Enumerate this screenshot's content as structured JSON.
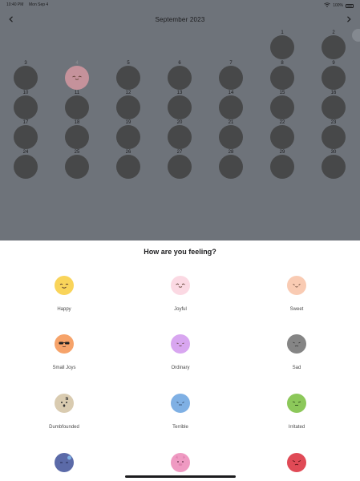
{
  "status_bar": {
    "time": "10:40 PM",
    "date": "Mon Sep 4",
    "battery": "100%",
    "wifi_icon": "wifi-icon",
    "battery_icon": "battery-icon"
  },
  "calendar": {
    "month_title": "September 2023",
    "prev_icon": "chevron-left-icon",
    "next_icon": "chevron-right-icon",
    "days": [
      {
        "day": "1",
        "mood": null
      },
      {
        "day": "2",
        "mood": null
      },
      {
        "day": "3",
        "mood": null
      },
      {
        "day": "4",
        "mood": "Joyful",
        "today": true
      },
      {
        "day": "5",
        "mood": null
      },
      {
        "day": "6",
        "mood": null
      },
      {
        "day": "7",
        "mood": null
      },
      {
        "day": "8",
        "mood": null
      },
      {
        "day": "9",
        "mood": null
      },
      {
        "day": "10",
        "mood": null
      },
      {
        "day": "11",
        "mood": null
      },
      {
        "day": "12",
        "mood": null
      },
      {
        "day": "13",
        "mood": null
      },
      {
        "day": "14",
        "mood": null
      },
      {
        "day": "15",
        "mood": null
      },
      {
        "day": "16",
        "mood": null
      },
      {
        "day": "17",
        "mood": null
      },
      {
        "day": "18",
        "mood": null
      },
      {
        "day": "19",
        "mood": null
      },
      {
        "day": "20",
        "mood": null
      },
      {
        "day": "21",
        "mood": null
      },
      {
        "day": "22",
        "mood": null
      },
      {
        "day": "23",
        "mood": null
      },
      {
        "day": "24",
        "mood": null
      },
      {
        "day": "25",
        "mood": null
      },
      {
        "day": "26",
        "mood": null
      },
      {
        "day": "27",
        "mood": null
      },
      {
        "day": "28",
        "mood": null
      },
      {
        "day": "29",
        "mood": null
      },
      {
        "day": "30",
        "mood": null
      }
    ],
    "first_weekday_index": 5
  },
  "sheet": {
    "title": "How are you feeling?",
    "moods": [
      {
        "label": "Happy",
        "color": "#f9d45a",
        "face": "happy"
      },
      {
        "label": "Joyful",
        "color": "#fbd9e3",
        "face": "joyful"
      },
      {
        "label": "Sweet",
        "color": "#f9cbb3",
        "face": "sweet"
      },
      {
        "label": "Small Joys",
        "color": "#f6a36a",
        "face": "cool"
      },
      {
        "label": "Ordinary",
        "color": "#d8a6f0",
        "face": "ordinary"
      },
      {
        "label": "Sad",
        "color": "#858585",
        "face": "sad"
      },
      {
        "label": "Dumbfounded",
        "color": "#d9cbb0",
        "face": "dumbfounded"
      },
      {
        "label": "Terrible",
        "color": "#7fb0e4",
        "face": "terrible"
      },
      {
        "label": "Irritated",
        "color": "#8cc85a",
        "face": "irritated"
      },
      {
        "label": "",
        "color": "#5b6aa8",
        "face": "sleepy"
      },
      {
        "label": "",
        "color": "#ef9ac2",
        "face": "pig"
      },
      {
        "label": "",
        "color": "#e04a56",
        "face": "angry"
      }
    ]
  },
  "colors": {
    "overlay": "#6e737a",
    "empty_day": "#474849",
    "today_mood": "#c5929b"
  }
}
